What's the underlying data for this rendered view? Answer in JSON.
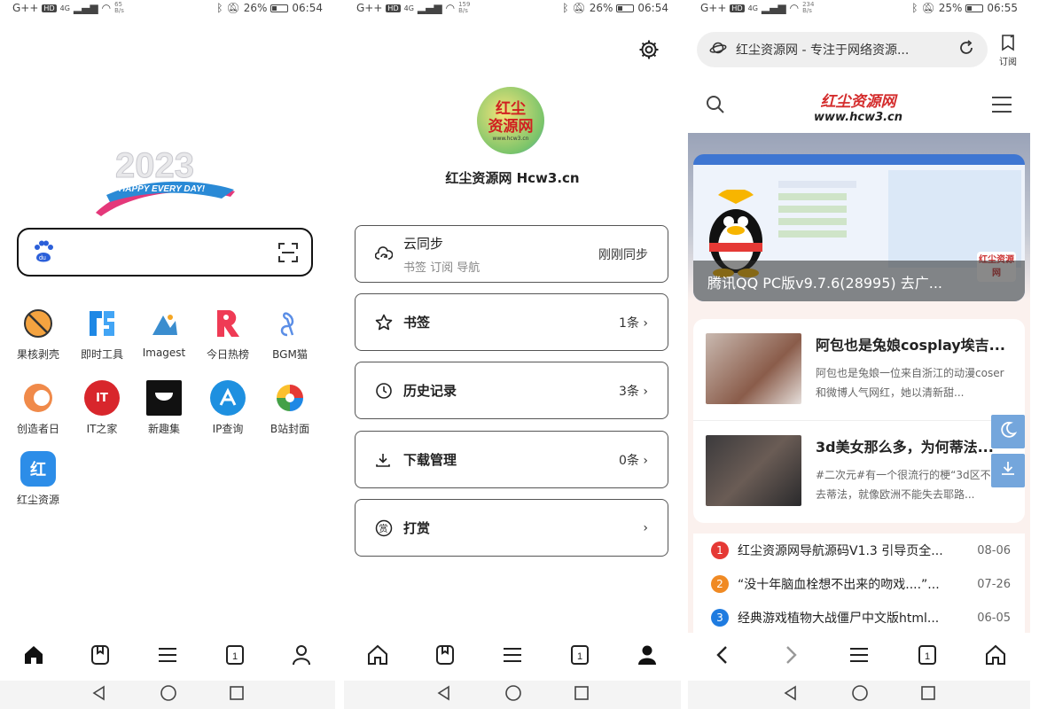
{
  "screen1": {
    "status": {
      "carrier": "G++",
      "hd": "HD",
      "net": "4G",
      "speed": "65 B/s",
      "battery": "26%",
      "time": "06:54"
    },
    "apps": [
      {
        "label": "果核剥壳",
        "glyph": "⃠",
        "color": "#f0a040"
      },
      {
        "label": "即时工具",
        "glyph": "JS",
        "color": "#1e88e5"
      },
      {
        "label": "Imagest",
        "glyph": "▲",
        "color": "#ffffff"
      },
      {
        "label": "今日热榜",
        "glyph": "R",
        "color": "#ef3b55"
      },
      {
        "label": "BGM猫",
        "glyph": "♪",
        "color": "#ffffff"
      },
      {
        "label": "创造者日",
        "glyph": "C",
        "color": "#f08a4a"
      },
      {
        "label": "IT之家",
        "glyph": "IT",
        "color": "#d8262c"
      },
      {
        "label": "新趣集",
        "glyph": "◡",
        "color": "#111111"
      },
      {
        "label": "IP查询",
        "glyph": "A",
        "color": "#1e90e0"
      },
      {
        "label": "B站封面",
        "glyph": "✚",
        "color": "#ffffff"
      },
      {
        "label": "红尘资源",
        "glyph": "红",
        "color": "#2c8de8"
      }
    ],
    "logo_text": "2023",
    "logo_sub": "HAPPY EVERY DAY!"
  },
  "screen2": {
    "status": {
      "carrier": "G++",
      "hd": "HD",
      "net": "4G",
      "speed": "159 B/s",
      "battery": "26%",
      "time": "06:54"
    },
    "site_logo_line1": "红尘",
    "site_logo_line2": "资源网",
    "site_logo_url": "www.hcw3.cn",
    "site_name": "红尘资源网 Hcw3.cn",
    "cards": {
      "sync": {
        "label": "云同步",
        "sub": "书签 订阅 导航",
        "value": "刚刚同步"
      },
      "bookmarks": {
        "label": "书签",
        "value": "1条 ›"
      },
      "history": {
        "label": "历史记录",
        "value": "3条 ›"
      },
      "downloads": {
        "label": "下载管理",
        "value": "0条 ›"
      },
      "reward": {
        "label": "打赏",
        "value": "›"
      }
    }
  },
  "screen3": {
    "status": {
      "carrier": "G++",
      "hd": "HD",
      "net": "4G",
      "speed": "234 B/s",
      "battery": "25%",
      "time": "06:55"
    },
    "url_title": "红尘资源网 - 专注于网络资源...",
    "subscribe_label": "订阅",
    "brand_title": "红尘资源网",
    "brand_url": "www.hcw3.cn",
    "banner_caption": "腾讯QQ PC版v9.7.6(28995) 去广...",
    "banner_badge": "红尘资源网",
    "articles": [
      {
        "title": "阿包也是兔娘cosplay埃吉...",
        "desc": "阿包也是兔娘一位来自浙江的动漫coser和微博人气网红，她以清新甜..."
      },
      {
        "title": "3d美女那么多，为何蒂法...",
        "desc": "#二次元#有一个很流行的梗“3d区不能失去蒂法，就像欧洲不能失去耶路..."
      }
    ],
    "news": [
      {
        "num": "1",
        "title": "红尘资源网导航源码V1.3 引导页全...",
        "date": "08-06",
        "color": "#e53935"
      },
      {
        "num": "2",
        "title": "“没十年脑血栓想不出来的吻戏....”...",
        "date": "07-26",
        "color": "#f08a24"
      },
      {
        "num": "3",
        "title": "经典游戏植物大战僵尸中文版html...",
        "date": "06-05",
        "color": "#1e7be0"
      }
    ]
  },
  "accent": "#74a6dc"
}
